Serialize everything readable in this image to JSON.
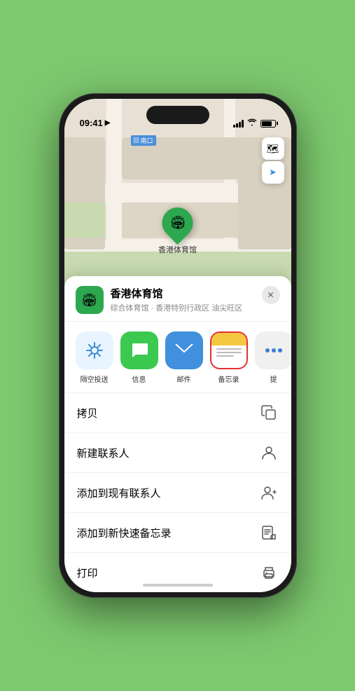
{
  "status_bar": {
    "time": "09:41",
    "arrow_symbol": "▶"
  },
  "map": {
    "label_nankou": "南口",
    "pin_label": "香港体育馆",
    "pin_emoji": "🏟️"
  },
  "map_controls": {
    "map_btn": "🗺",
    "location_btn": "➤"
  },
  "sheet": {
    "venue_emoji": "🏟️",
    "venue_name": "香港体育馆",
    "venue_subtitle": "综合体育馆 · 香港特别行政区 油尖旺区",
    "close_symbol": "✕"
  },
  "share_items": [
    {
      "id": "airdrop",
      "type": "airdrop",
      "label": "隔空投送"
    },
    {
      "id": "message",
      "type": "message",
      "label": "信息"
    },
    {
      "id": "mail",
      "type": "mail",
      "label": "邮件"
    },
    {
      "id": "notes",
      "type": "notes",
      "label": "备忘录"
    },
    {
      "id": "more",
      "type": "more",
      "label": "提"
    }
  ],
  "menu_items": [
    {
      "id": "copy",
      "label": "拷贝",
      "icon_type": "copy"
    },
    {
      "id": "new-contact",
      "label": "新建联系人",
      "icon_type": "person"
    },
    {
      "id": "add-existing",
      "label": "添加到现有联系人",
      "icon_type": "person-add"
    },
    {
      "id": "add-notes",
      "label": "添加到新快速备忘录",
      "icon_type": "note"
    },
    {
      "id": "print",
      "label": "打印",
      "icon_type": "print"
    }
  ]
}
